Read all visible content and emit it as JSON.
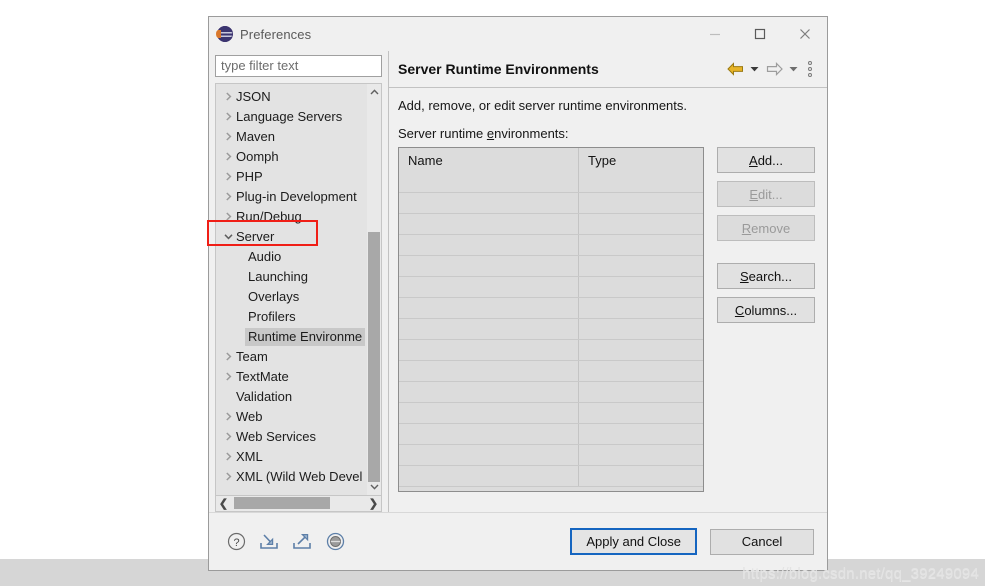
{
  "window": {
    "title": "Preferences",
    "icon": "eclipse-icon",
    "controls": {
      "minimize": "minimize-icon",
      "maximize": "maximize-icon",
      "close": "close-icon"
    }
  },
  "sidebar": {
    "filter": {
      "placeholder": "type filter text",
      "value": ""
    },
    "items": [
      {
        "label": "JSON",
        "level": 1,
        "expandable": true,
        "expanded": false,
        "selected": false
      },
      {
        "label": "Language Servers",
        "level": 1,
        "expandable": true,
        "expanded": false,
        "selected": false
      },
      {
        "label": "Maven",
        "level": 1,
        "expandable": true,
        "expanded": false,
        "selected": false
      },
      {
        "label": "Oomph",
        "level": 1,
        "expandable": true,
        "expanded": false,
        "selected": false
      },
      {
        "label": "PHP",
        "level": 1,
        "expandable": true,
        "expanded": false,
        "selected": false
      },
      {
        "label": "Plug-in Development",
        "level": 1,
        "expandable": true,
        "expanded": false,
        "selected": false
      },
      {
        "label": "Run/Debug",
        "level": 1,
        "expandable": true,
        "expanded": false,
        "selected": false
      },
      {
        "label": "Server",
        "level": 1,
        "expandable": true,
        "expanded": true,
        "selected": false
      },
      {
        "label": "Audio",
        "level": 2,
        "expandable": false,
        "expanded": false,
        "selected": false
      },
      {
        "label": "Launching",
        "level": 2,
        "expandable": false,
        "expanded": false,
        "selected": false
      },
      {
        "label": "Overlays",
        "level": 2,
        "expandable": false,
        "expanded": false,
        "selected": false
      },
      {
        "label": "Profilers",
        "level": 2,
        "expandable": false,
        "expanded": false,
        "selected": false
      },
      {
        "label": "Runtime Environme",
        "level": 2,
        "expandable": false,
        "expanded": false,
        "selected": true
      },
      {
        "label": "Team",
        "level": 1,
        "expandable": true,
        "expanded": false,
        "selected": false
      },
      {
        "label": "TextMate",
        "level": 1,
        "expandable": true,
        "expanded": false,
        "selected": false
      },
      {
        "label": "Validation",
        "level": 1,
        "expandable": false,
        "expanded": false,
        "selected": false
      },
      {
        "label": "Web",
        "level": 1,
        "expandable": true,
        "expanded": false,
        "selected": false
      },
      {
        "label": "Web Services",
        "level": 1,
        "expandable": true,
        "expanded": false,
        "selected": false
      },
      {
        "label": "XML",
        "level": 1,
        "expandable": true,
        "expanded": false,
        "selected": false
      },
      {
        "label": "XML (Wild Web Devel",
        "level": 1,
        "expandable": true,
        "expanded": false,
        "selected": false
      }
    ],
    "scrollbars": {
      "vertical": "vertical-scrollbar",
      "horizontal": "horizontal-scrollbar"
    }
  },
  "page": {
    "title": "Server Runtime Environments",
    "description": "Add, remove, or edit server runtime environments.",
    "field_label": "Server runtime environments:",
    "nav": {
      "back": "back-arrow-icon",
      "back_menu": "back-dropdown-icon",
      "forward": "forward-arrow-icon",
      "forward_menu": "forward-dropdown-icon",
      "view_menu": "view-menu-icon"
    },
    "table": {
      "columns": [
        "Name",
        "Type"
      ],
      "rows": [],
      "empty_row_count": 15
    },
    "buttons": [
      {
        "label": "Add...",
        "mnemonic": "A",
        "enabled": true,
        "name": "add-button"
      },
      {
        "label": "Edit...",
        "mnemonic": "E",
        "enabled": false,
        "name": "edit-button"
      },
      {
        "label": "Remove",
        "mnemonic": "R",
        "enabled": false,
        "name": "remove-button"
      },
      {
        "label": "Search...",
        "mnemonic": "S",
        "enabled": true,
        "name": "search-button"
      },
      {
        "label": "Columns...",
        "mnemonic": "C",
        "enabled": true,
        "name": "columns-button"
      }
    ]
  },
  "footer": {
    "icons": [
      {
        "name": "help-icon"
      },
      {
        "name": "import-icon"
      },
      {
        "name": "export-icon"
      },
      {
        "name": "restore-defaults-icon"
      }
    ],
    "apply_and_close": "Apply and Close",
    "cancel": "Cancel",
    "primary_color": "#1565c0"
  },
  "annotation": {
    "highlight_color": "#f01e16",
    "target": "Server"
  },
  "watermark": "https://blog.csdn.net/qq_39249094"
}
